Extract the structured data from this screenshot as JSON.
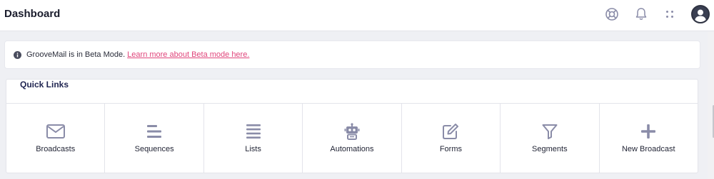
{
  "header": {
    "title": "Dashboard",
    "icons": [
      "help-lifebuoy-icon",
      "notification-bell-icon",
      "apps-grid-icon",
      "user-avatar"
    ]
  },
  "notice": {
    "text": "GrooveMail is in Beta Mode.",
    "link": "Learn more about Beta mode here."
  },
  "quick_links": {
    "title": "Quick Links",
    "items": [
      {
        "label": "Broadcasts",
        "icon": "envelope-icon"
      },
      {
        "label": "Sequences",
        "icon": "sequence-lines-icon"
      },
      {
        "label": "Lists",
        "icon": "list-icon"
      },
      {
        "label": "Automations",
        "icon": "robot-icon"
      },
      {
        "label": "Forms",
        "icon": "edit-form-icon"
      },
      {
        "label": "Segments",
        "icon": "filter-icon"
      },
      {
        "label": "New Broadcast",
        "icon": "plus-icon"
      }
    ]
  },
  "colors": {
    "accent_link": "#e0457b",
    "icon_gray": "#8a8ca8",
    "background": "#eff0f4"
  }
}
